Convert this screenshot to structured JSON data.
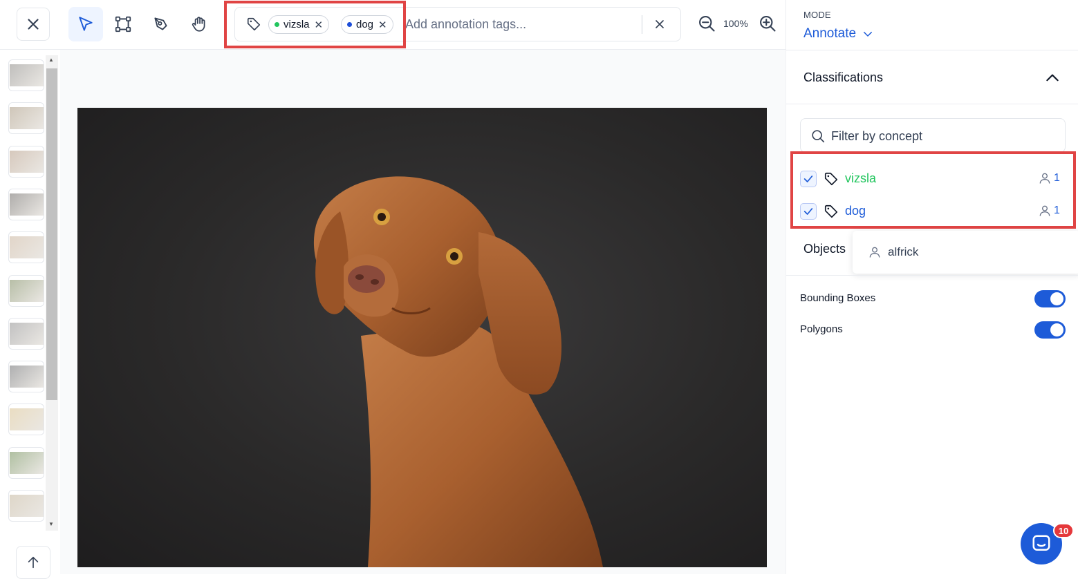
{
  "toolbar": {
    "tools": [
      "close-icon",
      "select-pointer-icon",
      "bounding-box-icon",
      "polygon-pen-icon",
      "pan-hand-icon"
    ],
    "tags": [
      {
        "label": "vizsla",
        "dot_color": "#22c55e"
      },
      {
        "label": "dog",
        "dot_color": "#1d4ed8"
      }
    ],
    "tag_input_placeholder": "Add annotation tags...",
    "zoom_level": "100%"
  },
  "thumbnails": {
    "count": 11,
    "colors": [
      "#8c8a86",
      "#a89880",
      "#b59c86",
      "#6e6a66",
      "#c9b39c",
      "#7d8a5f",
      "#8f8f8f",
      "#6d6e70",
      "#d8c190",
      "#6f8c55",
      "#c3b59c"
    ]
  },
  "panel": {
    "mode_label": "MODE",
    "mode_value": "Annotate",
    "classifications_title": "Classifications",
    "filter_placeholder": "Filter by concept",
    "concepts": [
      {
        "name": "vizsla",
        "count": "1",
        "color": "#22c55e"
      },
      {
        "name": "dog",
        "count": "1",
        "color": "#1d5bd8"
      }
    ],
    "objects_title": "Objects",
    "tooltip_user": "alfrick",
    "toggles": [
      {
        "label": "Bounding Boxes",
        "on": true
      },
      {
        "label": "Polygons",
        "on": true
      }
    ],
    "chat_badge": "10"
  },
  "colors": {
    "accent": "#1d5bd8",
    "highlight": "#e04444"
  }
}
